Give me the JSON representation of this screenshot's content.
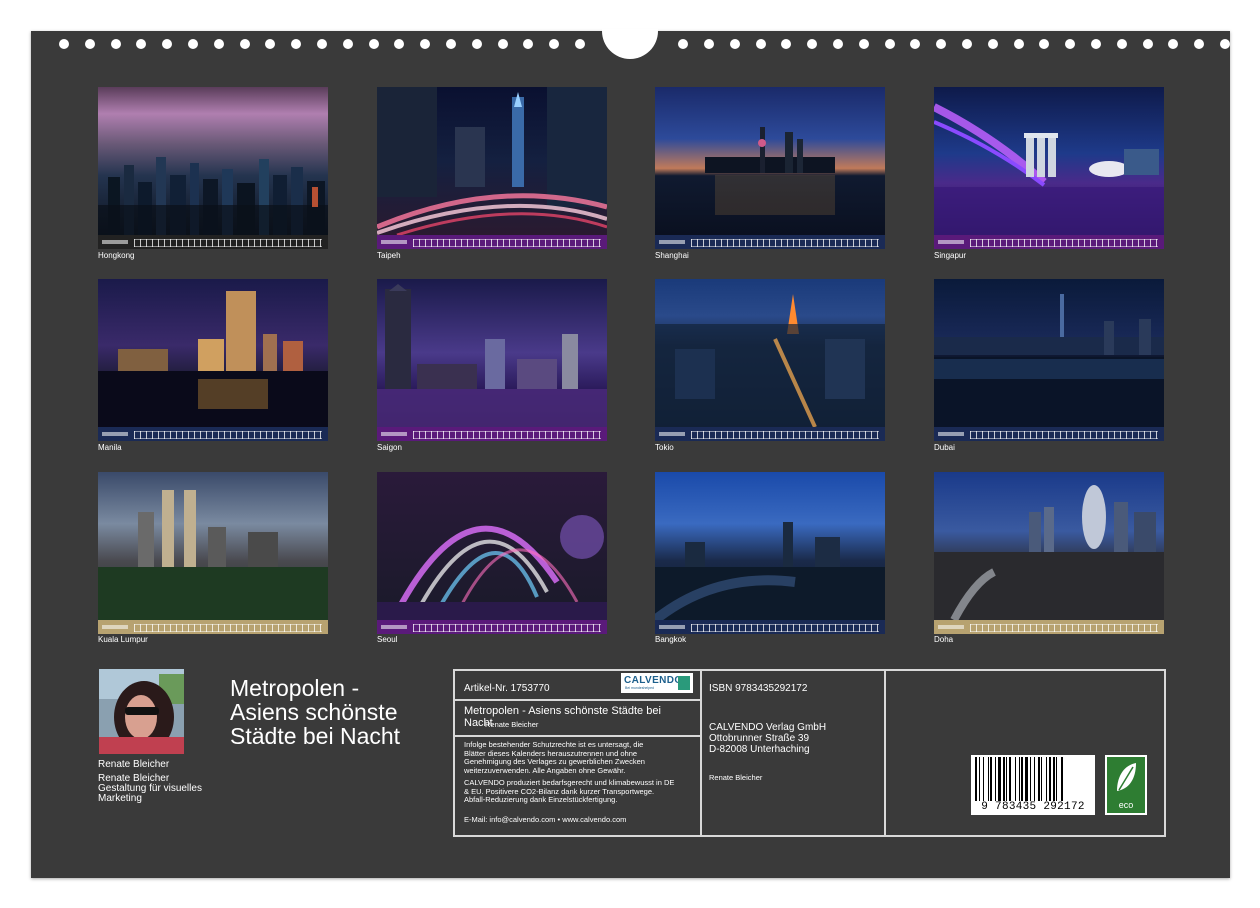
{
  "photos": [
    {
      "caption": "Hongkong"
    },
    {
      "caption": "Taipeh"
    },
    {
      "caption": "Shanghai"
    },
    {
      "caption": "Singapur"
    },
    {
      "caption": "Manila"
    },
    {
      "caption": "Saigon"
    },
    {
      "caption": "Tokio"
    },
    {
      "caption": "Dubai"
    },
    {
      "caption": "Kuala Lumpur"
    },
    {
      "caption": "Seoul"
    },
    {
      "caption": "Bangkok"
    },
    {
      "caption": "Doha"
    }
  ],
  "author": {
    "name": "Renate Bleicher",
    "credit_name": "Renate Bleicher",
    "credit_role_1": "Gestaltung für visuelles",
    "credit_role_2": "Marketing"
  },
  "title": {
    "line1": "Metropolen -",
    "line2": "Asiens schönste",
    "line3": "Städte bei Nacht"
  },
  "info": {
    "article": "Artikel-Nr. 1753770",
    "logo_text": "CALVENDO",
    "logo_sub": "Bei mundeshelped",
    "product_title_1": "Metropolen - Asiens schönste Städte bei",
    "product_title_2": "Nacht",
    "product_author": "Renate Bleicher",
    "legal_1": "Infolge bestehender Schutzrechte ist es untersagt, die",
    "legal_2": "Blätter dieses Kalenders herauszutrennen und ohne",
    "legal_3": "Genehmigung des Verlages zu gewerblichen Zwecken",
    "legal_4": "weiterzuverwenden. Alle Angaben ohne Gewähr.",
    "eco_1": "CALVENDO produziert bedarfsgerecht und klimabewusst in DE",
    "eco_2": "& EU. Positivere CO2-Bilanz dank kurzer Transportwege.",
    "eco_3": "Abfall-Reduzierung dank Einzelstückfertigung.",
    "contact": "E-Mail: info@calvendo.com • www.calvendo.com",
    "isbn": "ISBN 9783435292172",
    "publisher_1": "CALVENDO Verlag GmbH",
    "publisher_2": "Ottobrunner Straße 39",
    "publisher_3": "D-82008 Unterhaching",
    "publisher_author": "Renate Bleicher",
    "barcode_number": "9 783435 292172",
    "eco_label": "eco"
  },
  "colors": {
    "page_background": "#3a3a3a",
    "strip_blue": "#1a2a55",
    "strip_purple": "#5a1a7a",
    "strip_gold": "#b7a270",
    "eco_green": "#2e7d32",
    "calvendo_blue": "#1c5f8c"
  }
}
